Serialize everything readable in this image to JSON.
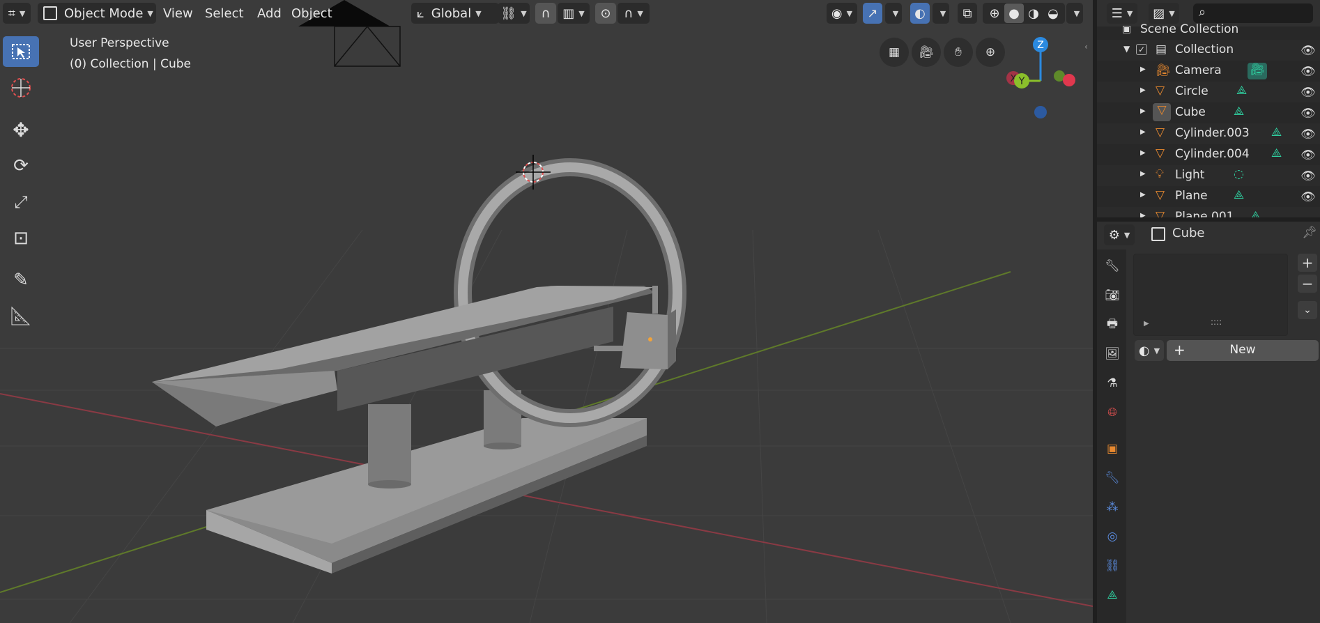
{
  "header": {
    "mode_label": "Object Mode",
    "menus": [
      "View",
      "Select",
      "Add",
      "Object"
    ],
    "orientation_label": "Global"
  },
  "viewport": {
    "perspective_label": "User Perspective",
    "collection_label": "(0) Collection | Cube",
    "gizmo_axes": {
      "x": "X",
      "y": "Y",
      "z": "Z"
    }
  },
  "toolbar": {
    "tools": [
      "select-box-icon",
      "cursor-icon",
      "move-icon",
      "rotate-icon",
      "scale-icon",
      "transform-icon",
      "annotate-icon",
      "measure-icon"
    ]
  },
  "outliner": {
    "scene_collection_label": "Scene Collection",
    "collection_label": "Collection",
    "items": [
      {
        "name": "Camera",
        "type": "camera"
      },
      {
        "name": "Circle",
        "type": "mesh"
      },
      {
        "name": "Cube",
        "type": "mesh"
      },
      {
        "name": "Cylinder.003",
        "type": "mesh"
      },
      {
        "name": "Cylinder.004",
        "type": "mesh"
      },
      {
        "name": "Light",
        "type": "light"
      },
      {
        "name": "Plane",
        "type": "mesh"
      },
      {
        "name": "Plane.001",
        "type": "mesh"
      }
    ]
  },
  "properties": {
    "object_name": "Cube",
    "new_button_label": "New",
    "slot_dots": "::::"
  },
  "colors": {
    "accent": "#4772b3",
    "mesh_orange": "#e8892f",
    "data_green": "#2fd1a1",
    "axis_x": "#e0384e",
    "axis_y": "#8bbf2b",
    "axis_z": "#2b8ae0"
  }
}
